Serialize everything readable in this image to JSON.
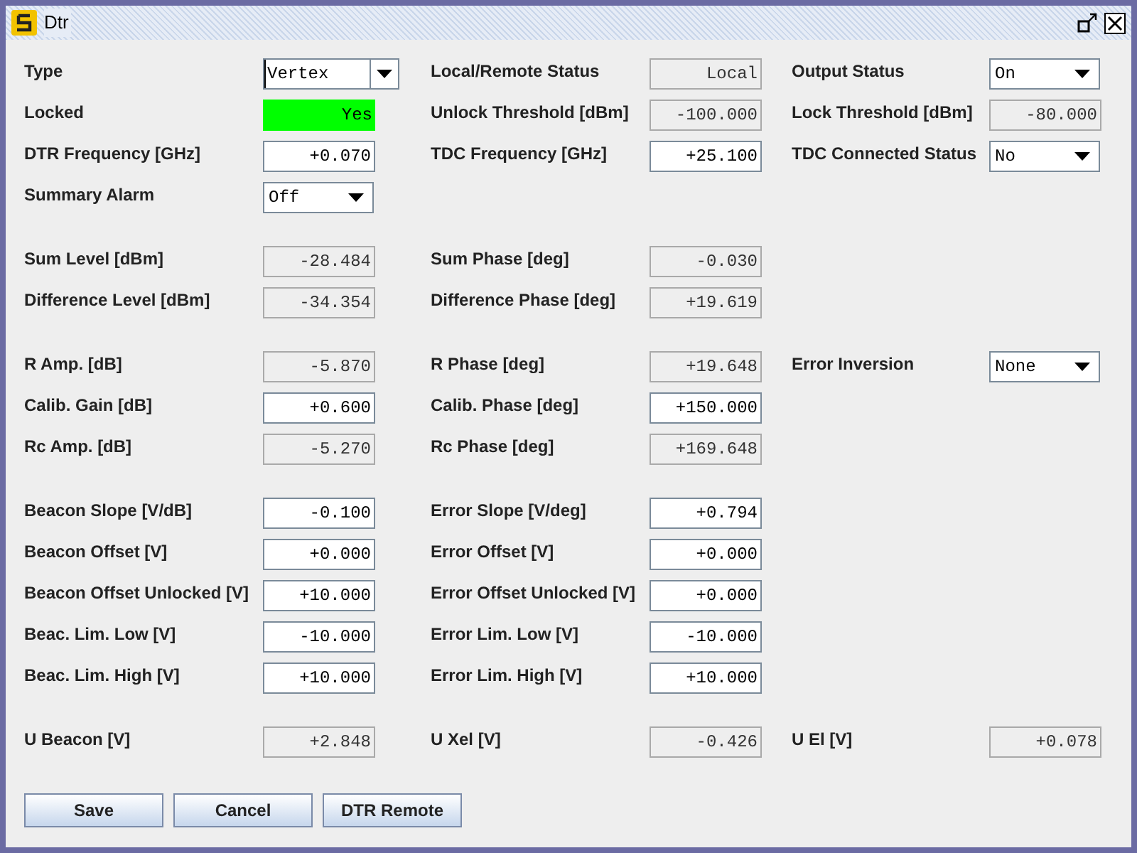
{
  "window": {
    "title": "Dtr"
  },
  "sections": [
    {
      "rows": [
        [
          {
            "label": "Type",
            "field": {
              "kind": "combo",
              "value": "Vertex"
            }
          },
          {
            "label": "Local/Remote Status",
            "field": {
              "kind": "text",
              "value": "Local",
              "editable": false
            }
          },
          {
            "label": "Output Status",
            "field": {
              "kind": "dropdown",
              "value": "On"
            }
          }
        ],
        [
          {
            "label": "Locked",
            "field": {
              "kind": "indicator",
              "value": "Yes",
              "color": "#00ff00"
            }
          },
          {
            "label": "Unlock Threshold [dBm]",
            "field": {
              "kind": "text",
              "value": "-100.000",
              "editable": false
            }
          },
          {
            "label": "Lock Threshold [dBm]",
            "field": {
              "kind": "text",
              "value": "-80.000",
              "editable": false
            }
          }
        ],
        [
          {
            "label": "DTR Frequency [GHz]",
            "field": {
              "kind": "text",
              "value": "+0.070",
              "editable": true
            }
          },
          {
            "label": "TDC Frequency [GHz]",
            "field": {
              "kind": "text",
              "value": "+25.100",
              "editable": true
            }
          },
          {
            "label": "TDC Connected Status",
            "field": {
              "kind": "dropdown",
              "value": "No"
            }
          }
        ],
        [
          {
            "label": "Summary Alarm",
            "field": {
              "kind": "dropdown",
              "value": "Off"
            }
          }
        ]
      ]
    },
    {
      "rows": [
        [
          {
            "label": "Sum Level [dBm]",
            "field": {
              "kind": "text",
              "value": "-28.484",
              "editable": false
            }
          },
          {
            "label": "Sum Phase [deg]",
            "field": {
              "kind": "text",
              "value": "-0.030",
              "editable": false
            }
          }
        ],
        [
          {
            "label": "Difference Level [dBm]",
            "field": {
              "kind": "text",
              "value": "-34.354",
              "editable": false
            }
          },
          {
            "label": "Difference Phase [deg]",
            "field": {
              "kind": "text",
              "value": "+19.619",
              "editable": false
            }
          }
        ]
      ]
    },
    {
      "rows": [
        [
          {
            "label": "R Amp. [dB]",
            "field": {
              "kind": "text",
              "value": "-5.870",
              "editable": false
            }
          },
          {
            "label": "R Phase [deg]",
            "field": {
              "kind": "text",
              "value": "+19.648",
              "editable": false
            }
          },
          {
            "label": "Error Inversion",
            "field": {
              "kind": "dropdown",
              "value": "None"
            }
          }
        ],
        [
          {
            "label": "Calib. Gain [dB]",
            "field": {
              "kind": "text",
              "value": "+0.600",
              "editable": true
            }
          },
          {
            "label": "Calib. Phase [deg]",
            "field": {
              "kind": "text",
              "value": "+150.000",
              "editable": true
            }
          }
        ],
        [
          {
            "label": "Rc Amp. [dB]",
            "field": {
              "kind": "text",
              "value": "-5.270",
              "editable": false
            }
          },
          {
            "label": "Rc Phase [deg]",
            "field": {
              "kind": "text",
              "value": "+169.648",
              "editable": false
            }
          }
        ]
      ]
    },
    {
      "rows": [
        [
          {
            "label": "Beacon Slope [V/dB]",
            "field": {
              "kind": "text",
              "value": "-0.100",
              "editable": true
            }
          },
          {
            "label": "Error Slope [V/deg]",
            "field": {
              "kind": "text",
              "value": "+0.794",
              "editable": true
            }
          }
        ],
        [
          {
            "label": "Beacon Offset [V]",
            "field": {
              "kind": "text",
              "value": "+0.000",
              "editable": true
            }
          },
          {
            "label": "Error Offset [V]",
            "field": {
              "kind": "text",
              "value": "+0.000",
              "editable": true
            }
          }
        ],
        [
          {
            "label": "Beacon Offset Unlocked [V]",
            "field": {
              "kind": "text",
              "value": "+10.000",
              "editable": true
            }
          },
          {
            "label": "Error Offset Unlocked [V]",
            "field": {
              "kind": "text",
              "value": "+0.000",
              "editable": true
            }
          }
        ],
        [
          {
            "label": "Beac. Lim. Low [V]",
            "field": {
              "kind": "text",
              "value": "-10.000",
              "editable": true
            }
          },
          {
            "label": "Error Lim. Low [V]",
            "field": {
              "kind": "text",
              "value": "-10.000",
              "editable": true
            }
          }
        ],
        [
          {
            "label": "Beac. Lim. High [V]",
            "field": {
              "kind": "text",
              "value": "+10.000",
              "editable": true
            }
          },
          {
            "label": "Error Lim. High [V]",
            "field": {
              "kind": "text",
              "value": "+10.000",
              "editable": true
            }
          }
        ]
      ]
    },
    {
      "rows": [
        [
          {
            "label": "U Beacon [V]",
            "field": {
              "kind": "text",
              "value": "+2.848",
              "editable": false
            }
          },
          {
            "label": "U Xel [V]",
            "field": {
              "kind": "text",
              "value": "-0.426",
              "editable": false
            }
          },
          {
            "label": "U El [V]",
            "field": {
              "kind": "text",
              "value": "+0.078",
              "editable": false
            }
          }
        ]
      ]
    }
  ],
  "buttons": [
    {
      "label": "Save"
    },
    {
      "label": "Cancel"
    },
    {
      "label": "DTR Remote"
    }
  ]
}
